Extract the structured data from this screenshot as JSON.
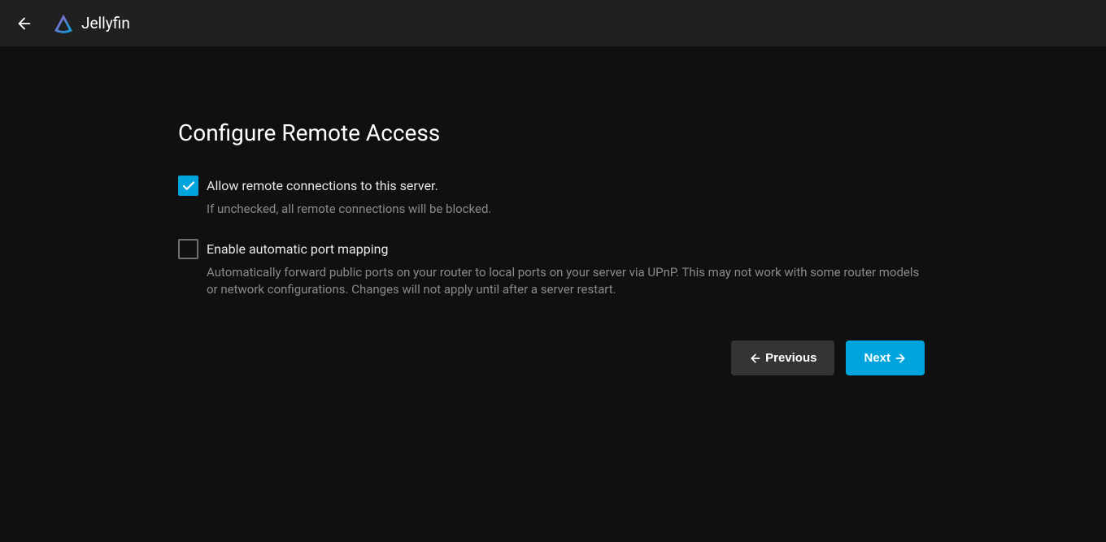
{
  "header": {
    "app_name": "Jellyfin"
  },
  "page": {
    "title": "Configure Remote Access",
    "options": [
      {
        "label": "Allow remote connections to this server.",
        "description": "If unchecked, all remote connections will be blocked.",
        "checked": true
      },
      {
        "label": "Enable automatic port mapping",
        "description": "Automatically forward public ports on your router to local ports on your server via UPnP. This may not work with some router models or network configurations. Changes will not apply until after a server restart.",
        "checked": false
      }
    ],
    "nav": {
      "previous_label": "Previous",
      "next_label": "Next"
    }
  }
}
